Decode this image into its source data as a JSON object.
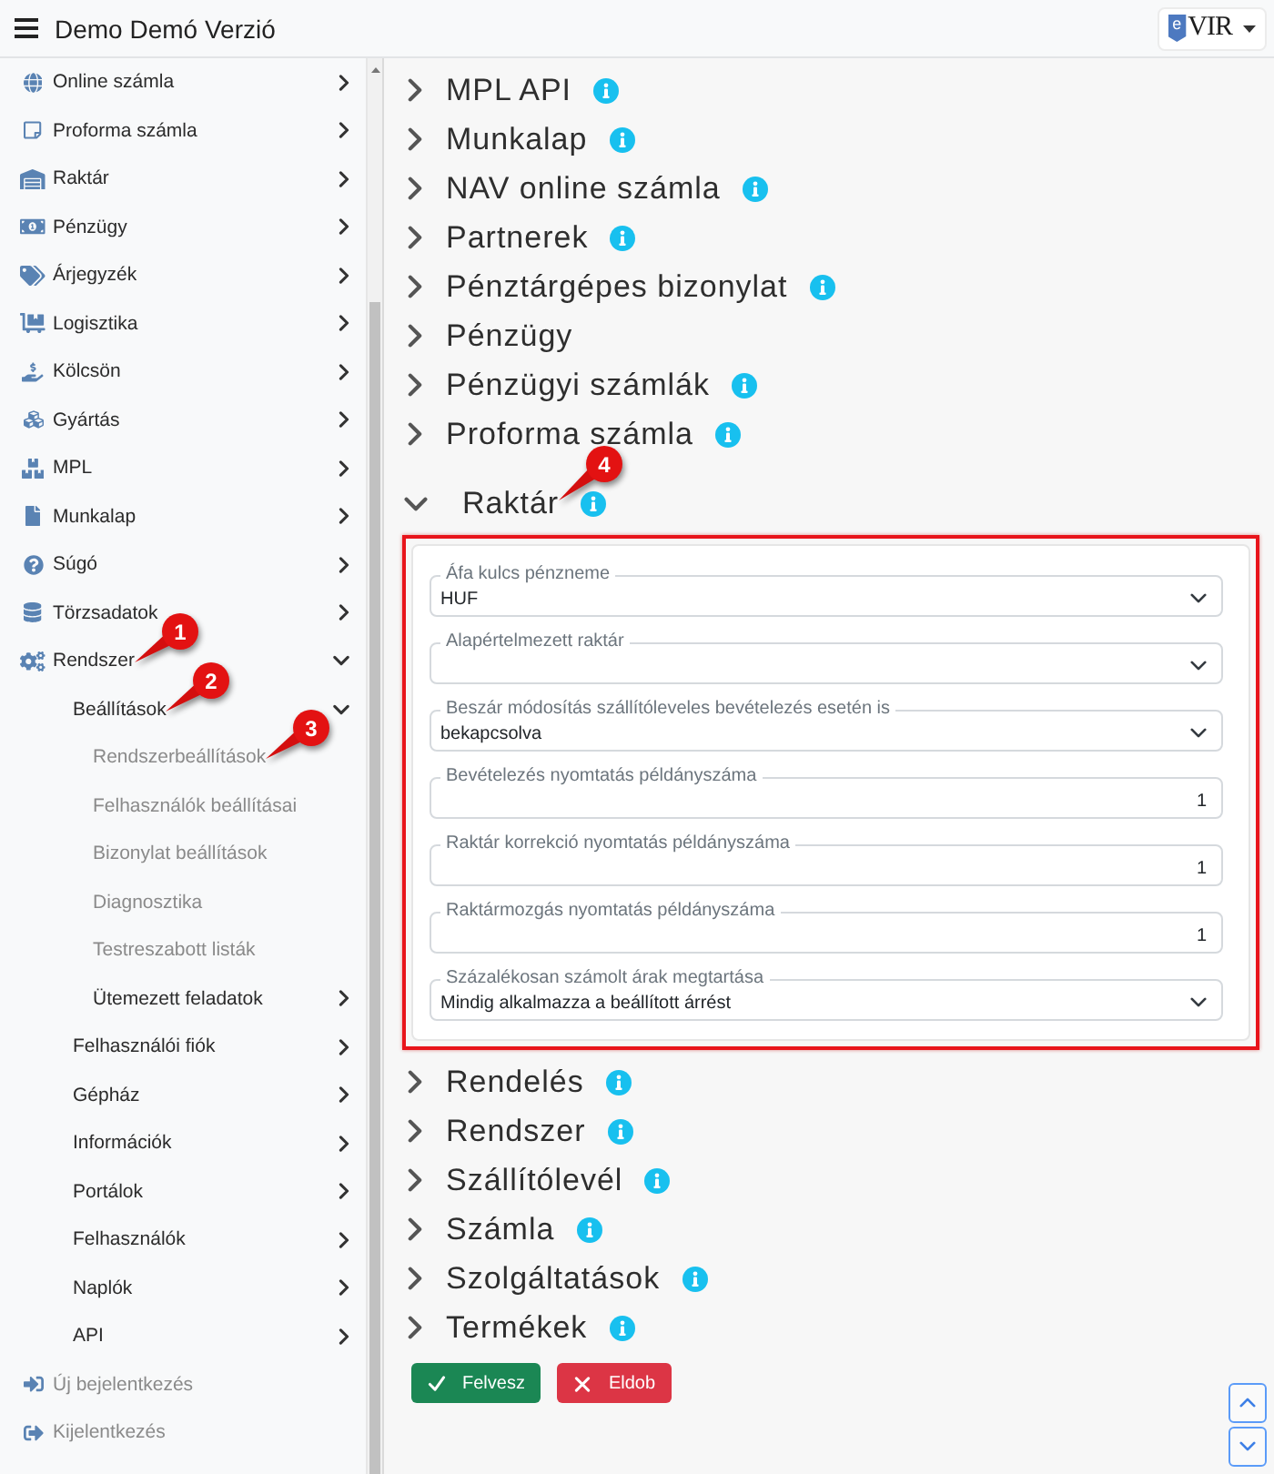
{
  "header": {
    "title": "Demo Demó Verzió",
    "logo": {
      "badge": "e",
      "text": "VIR"
    }
  },
  "sidebar": {
    "items": [
      {
        "label": "Online számla",
        "kind": "menu",
        "expanded": false
      },
      {
        "label": "Proforma számla",
        "kind": "menu",
        "expanded": false
      },
      {
        "label": "Raktár",
        "kind": "menu",
        "expanded": false
      },
      {
        "label": "Pénzügy",
        "kind": "menu",
        "expanded": false
      },
      {
        "label": "Árjegyzék",
        "kind": "menu",
        "expanded": false
      },
      {
        "label": "Logisztika",
        "kind": "menu",
        "expanded": false
      },
      {
        "label": "Kölcsön",
        "kind": "menu",
        "expanded": false
      },
      {
        "label": "Gyártás",
        "kind": "menu",
        "expanded": false
      },
      {
        "label": "MPL",
        "kind": "menu",
        "expanded": false
      },
      {
        "label": "Munkalap",
        "kind": "menu",
        "expanded": false
      },
      {
        "label": "Súgó",
        "kind": "menu",
        "expanded": false
      },
      {
        "label": "Törzsadatok",
        "kind": "menu",
        "expanded": false
      },
      {
        "label": "Rendszer",
        "kind": "menu",
        "expanded": true,
        "callout": "1",
        "children": [
          {
            "label": "Beállítások",
            "kind": "menu",
            "expanded": true,
            "callout": "2",
            "children": [
              {
                "label": "Rendszerbeállítások",
                "kind": "link",
                "callout": "3"
              },
              {
                "label": "Felhasználók beállításai",
                "kind": "link"
              },
              {
                "label": "Bizonylat beállítások",
                "kind": "link"
              },
              {
                "label": "Diagnosztika",
                "kind": "link"
              },
              {
                "label": "Testreszabott listák",
                "kind": "link"
              },
              {
                "label": "Ütemezett feladatok",
                "kind": "menu",
                "expanded": false
              }
            ]
          },
          {
            "label": "Felhasználói fiók",
            "kind": "menu",
            "expanded": false
          },
          {
            "label": "Gépház",
            "kind": "menu",
            "expanded": false
          },
          {
            "label": "Információk",
            "kind": "menu",
            "expanded": false
          },
          {
            "label": "Portálok",
            "kind": "menu",
            "expanded": false
          },
          {
            "label": "Felhasználók",
            "kind": "menu",
            "expanded": false
          },
          {
            "label": "Naplók",
            "kind": "menu",
            "expanded": false
          },
          {
            "label": "API",
            "kind": "menu",
            "expanded": false
          }
        ]
      },
      {
        "label": "Új bejelentkezés",
        "kind": "link"
      },
      {
        "label": "Kijelentkezés",
        "kind": "link"
      }
    ]
  },
  "sections": [
    {
      "title": "MPL API",
      "info": true,
      "expanded": false
    },
    {
      "title": "Munkalap",
      "info": true,
      "expanded": false
    },
    {
      "title": "NAV online számla",
      "info": true,
      "expanded": false
    },
    {
      "title": "Partnerek",
      "info": true,
      "expanded": false
    },
    {
      "title": "Pénztárgépes bizonylat",
      "info": true,
      "expanded": false
    },
    {
      "title": "Pénzügy",
      "info": false,
      "expanded": false
    },
    {
      "title": "Pénzügyi számlák",
      "info": true,
      "expanded": false
    },
    {
      "title": "Proforma számla",
      "info": true,
      "expanded": false
    },
    {
      "title": "Raktár",
      "info": true,
      "expanded": true,
      "callout": "4",
      "panel": {
        "highlighted": true,
        "fields": [
          {
            "kind": "select",
            "label": "Áfa kulcs pénzneme",
            "value": "HUF"
          },
          {
            "kind": "select",
            "label": "Alapértelmezett raktár"
          },
          {
            "kind": "select",
            "label": "Beszár módosítás szállítóleveles bevételezés esetén is",
            "value": "bekapcsolva"
          },
          {
            "kind": "number",
            "label": "Bevételezés nyomtatás példányszáma",
            "value": "1"
          },
          {
            "kind": "number",
            "label": "Raktár korrekció nyomtatás példányszáma",
            "value": "1"
          },
          {
            "kind": "number",
            "label": "Raktármozgás nyomtatás példányszáma",
            "value": "1"
          },
          {
            "kind": "select",
            "label": "Százalékosan számolt árak megtartása",
            "value": "Mindig alkalmazza a beállított árrést"
          }
        ]
      }
    },
    {
      "title": "Rendelés",
      "info": true,
      "expanded": false
    },
    {
      "title": "Rendszer",
      "info": true,
      "expanded": false
    },
    {
      "title": "Szállítólevél",
      "info": true,
      "expanded": false
    },
    {
      "title": "Számla",
      "info": true,
      "expanded": false
    },
    {
      "title": "Szolgáltatások",
      "info": true,
      "expanded": false
    },
    {
      "title": "Termékek",
      "info": true,
      "expanded": false
    }
  ],
  "buttons": [
    {
      "kind": "confirm",
      "label": "Felvesz"
    },
    {
      "kind": "discard",
      "label": "Eldob"
    }
  ]
}
